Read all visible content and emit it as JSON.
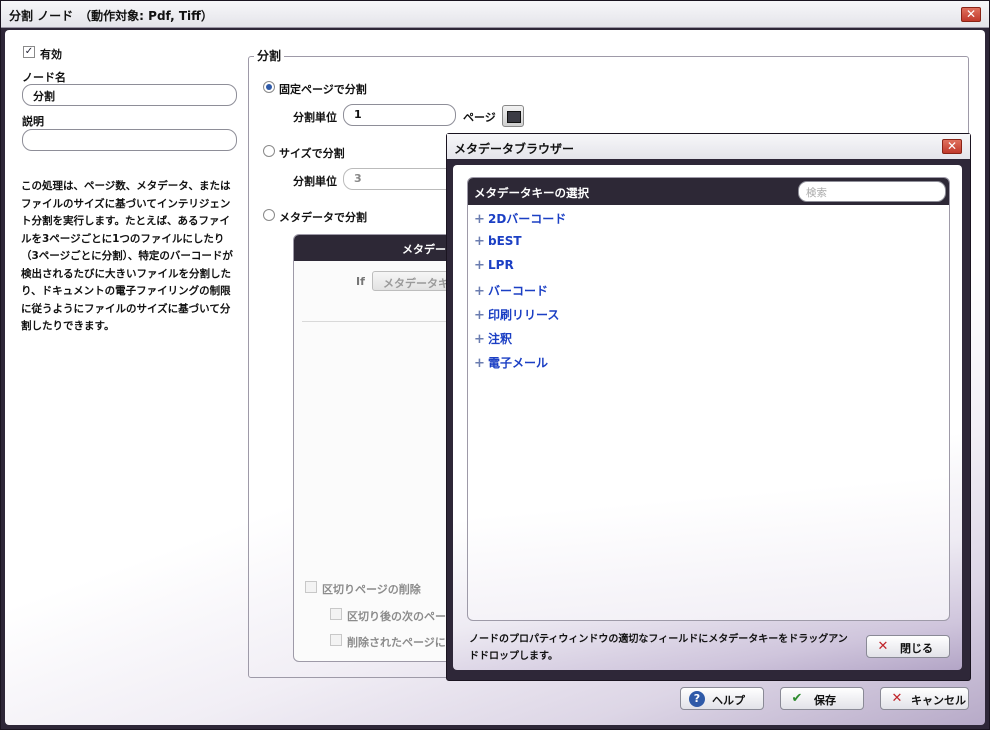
{
  "window": {
    "title": "分割 ノード　（動作対象: Pdf, Tiff）",
    "close_glyph": "✕"
  },
  "left": {
    "enabled_label": "有効",
    "enabled_checked": true,
    "check_glyph": "✓",
    "node_name_label": "ノード名",
    "node_name_value": "分割",
    "description_label": "説明",
    "description_value": "",
    "help_text": "この処理は、ページ数、メタデータ、またはファイルのサイズに基づいてインテリジェント分割を実行します。たとえば、あるファイルを3ページごとに1つのファイルにしたり（3ページごとに分割）、特定のバーコードが検出されるたびに大きいファイルを分割したり、ドキュメントの電子ファイリングの制限に従うようにファイルのサイズに基づいて分割したりできます。"
  },
  "split": {
    "group_title": "分割",
    "fixed_page_option": "固定ページで分割",
    "fixed_page_selected": true,
    "unit_label": "分割単位",
    "unit_value": "1",
    "unit_suffix": "ページ",
    "size_option": "サイズで分割",
    "size_unit_label": "分割単位",
    "size_unit_value": "3",
    "metadata_option": "メタデータで分割",
    "metadata_panel_title": "メタデー",
    "if_label": "If",
    "metadata_key_button": "メタデータキ",
    "delete_separator_label": "区切りページの削除",
    "next_page_label": "区切り後の次のペー",
    "deleted_page_label": "削除されたページに"
  },
  "buttons": {
    "help": "ヘルプ",
    "save": "保存",
    "cancel": "キャンセル",
    "help_glyph": "?",
    "save_glyph": "✔",
    "cancel_glyph": "✕"
  },
  "metadata_browser": {
    "title": "メタデータブラウザー",
    "close_glyph": "✕",
    "header": "メタデータキーの選択",
    "search_placeholder": "検索",
    "plus_glyph": "+",
    "items": [
      {
        "label": "2Dバーコード"
      },
      {
        "label": "bEST"
      },
      {
        "label": "LPR"
      },
      {
        "label": "バーコード"
      },
      {
        "label": "印刷リリース"
      },
      {
        "label": "注釈"
      },
      {
        "label": "電子メール"
      }
    ],
    "note": "ノードのプロパティウィンドウの適切なフィールドにメタデータキーをドラッグアンドドロップします。",
    "close_button": "閉じる"
  },
  "colors": {
    "title_bar_dark": "#2d2836",
    "link_blue": "#1b3fc4",
    "close_red": "#c0392b"
  },
  "icons": [
    "close-icon",
    "check-icon",
    "radio-icon",
    "metadata-picker-icon",
    "help-icon",
    "save-icon",
    "cancel-icon",
    "plus-icon"
  ]
}
